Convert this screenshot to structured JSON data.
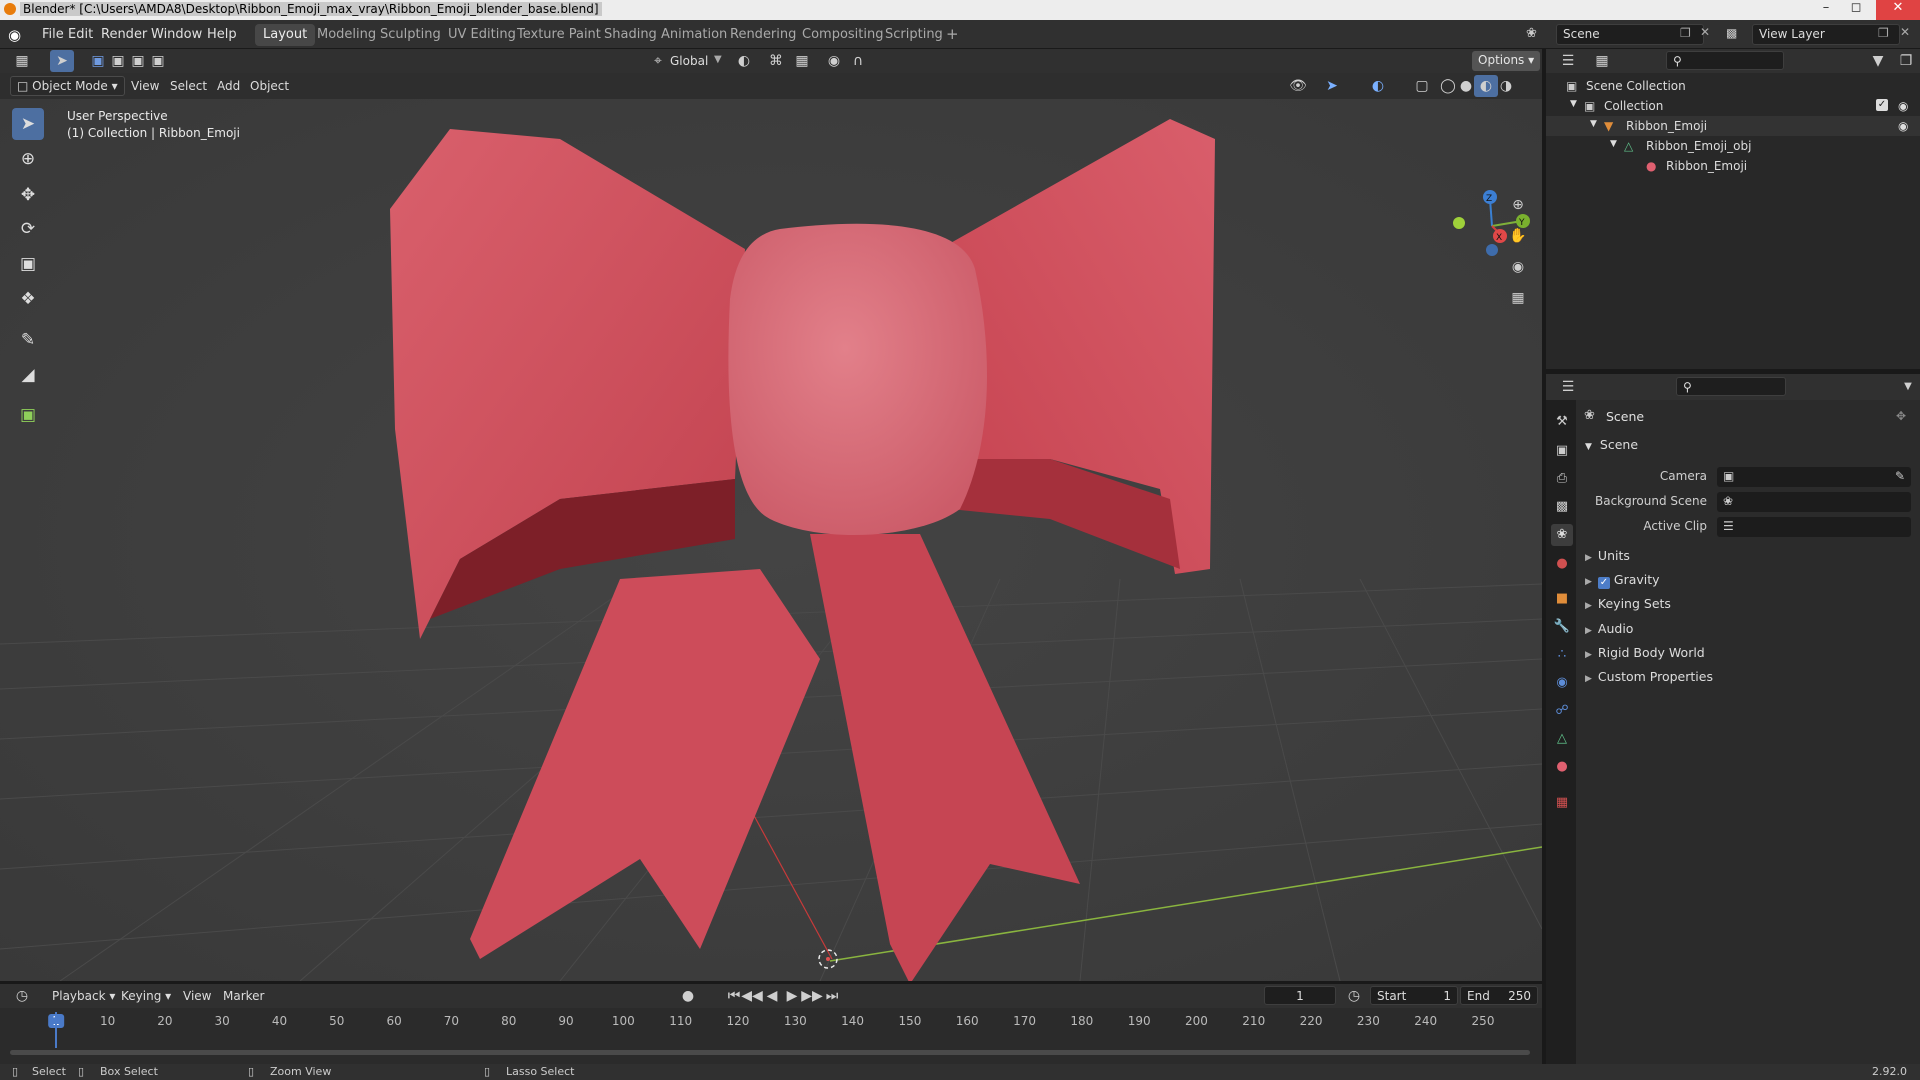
{
  "window": {
    "title": "Blender* [C:\\Users\\AMDA8\\Desktop\\Ribbon_Emoji_max_vray\\Ribbon_Emoji_blender_base.blend]"
  },
  "menu": {
    "items": [
      "File",
      "Edit",
      "Render",
      "Window",
      "Help"
    ]
  },
  "workspaces": [
    {
      "label": "Layout",
      "active": true
    },
    {
      "label": "Modeling"
    },
    {
      "label": "Sculpting"
    },
    {
      "label": "UV Editing"
    },
    {
      "label": "Texture Paint"
    },
    {
      "label": "Shading"
    },
    {
      "label": "Animation"
    },
    {
      "label": "Rendering"
    },
    {
      "label": "Compositing"
    },
    {
      "label": "Scripting"
    }
  ],
  "scene_field": "Scene",
  "view_layer_field": "View Layer",
  "tool_header": {
    "orientation": "Global",
    "options": "Options"
  },
  "viewport_header": {
    "mode": "Object Mode",
    "menus": [
      "View",
      "Select",
      "Add",
      "Object"
    ]
  },
  "viewport": {
    "perspective_label": "User Perspective",
    "collection_label": "(1) Collection | Ribbon_Emoji",
    "gizmo_axes": {
      "x": "X",
      "y": "Y",
      "z": "Z"
    },
    "object_color": "#d4505e"
  },
  "toolbar_tools": [
    "select-box",
    "cursor",
    "move",
    "rotate",
    "scale",
    "transform",
    "annotate",
    "measure",
    "add-cube"
  ],
  "outliner": {
    "root": "Scene Collection",
    "collection": "Collection",
    "object": "Ribbon_Emoji",
    "mesh": "Ribbon_Emoji_obj",
    "material": "Ribbon_Emoji"
  },
  "properties": {
    "context_title": "Scene",
    "panel_title": "Scene",
    "fields": [
      {
        "label": "Camera"
      },
      {
        "label": "Background Scene"
      },
      {
        "label": "Active Clip"
      }
    ],
    "sections": [
      {
        "label": "Units",
        "checkbox": false
      },
      {
        "label": "Gravity",
        "checkbox": true,
        "checked": true
      },
      {
        "label": "Keying Sets",
        "checkbox": false
      },
      {
        "label": "Audio",
        "checkbox": false
      },
      {
        "label": "Rigid Body World",
        "checkbox": false
      },
      {
        "label": "Custom Properties",
        "checkbox": false
      }
    ]
  },
  "timeline": {
    "menus": [
      "Playback",
      "Keying",
      "View",
      "Marker"
    ],
    "current_frame": "1",
    "start_label": "Start",
    "start": "1",
    "end_label": "End",
    "end": "250",
    "ticks": [
      "1",
      "10",
      "20",
      "30",
      "40",
      "50",
      "60",
      "70",
      "80",
      "90",
      "100",
      "110",
      "120",
      "130",
      "140",
      "150",
      "160",
      "170",
      "180",
      "190",
      "200",
      "210",
      "220",
      "230",
      "240",
      "250"
    ]
  },
  "statusbar": {
    "select": "Select",
    "box_select": "Box Select",
    "zoom_view": "Zoom View",
    "lasso_select": "Lasso Select",
    "version": "2.92.0"
  }
}
